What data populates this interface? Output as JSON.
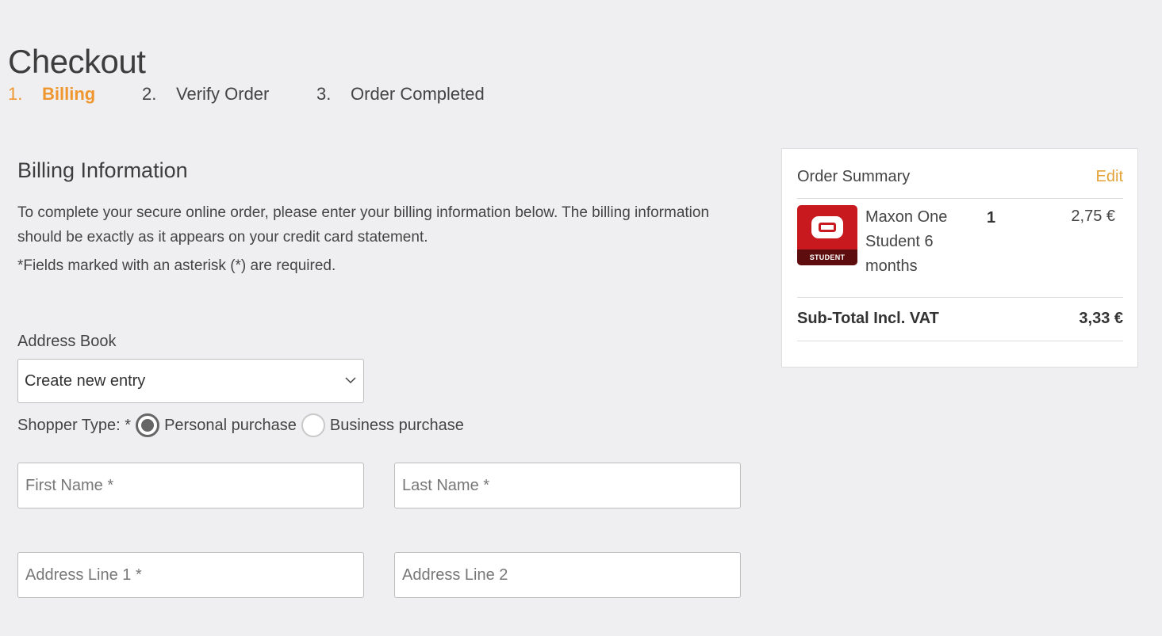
{
  "header": {
    "title": "Checkout"
  },
  "steps": [
    {
      "num": "1.",
      "label": "Billing",
      "active": true
    },
    {
      "num": "2.",
      "label": "Verify Order",
      "active": false
    },
    {
      "num": "3.",
      "label": "Order Completed",
      "active": false
    }
  ],
  "billing": {
    "title": "Billing Information",
    "intro": "To complete your secure online order, please enter your billing information below. The billing information should be exactly as it appears on your credit card statement.",
    "required_note": "*Fields marked with an asterisk (*) are required.",
    "address_book": {
      "label": "Address Book",
      "selected": "Create new entry"
    },
    "shopper_type": {
      "label": "Shopper Type: *",
      "options": [
        {
          "label": "Personal purchase",
          "checked": true
        },
        {
          "label": "Business purchase",
          "checked": false
        }
      ]
    },
    "fields": {
      "first_name": {
        "placeholder": "First Name *",
        "value": ""
      },
      "last_name": {
        "placeholder": "Last Name *",
        "value": ""
      },
      "address_line_1": {
        "placeholder": "Address Line 1 *",
        "value": ""
      },
      "address_line_2": {
        "placeholder": "Address Line 2",
        "value": ""
      }
    }
  },
  "summary": {
    "title": "Order Summary",
    "edit_label": "Edit",
    "item": {
      "name": "Maxon One Student 6 months",
      "badge": "STUDENT",
      "qty": "1",
      "price": "2,75 €"
    },
    "subtotal_label": "Sub-Total Incl. VAT",
    "subtotal_value": "3,33 €"
  },
  "colors": {
    "accent": "#f0962f",
    "edit_link": "#e3a136",
    "product_red": "#c8191f",
    "background": "#efeff1"
  },
  "icons": {
    "select": "chevron-down-icon",
    "product": "maxon-logo-icon"
  }
}
